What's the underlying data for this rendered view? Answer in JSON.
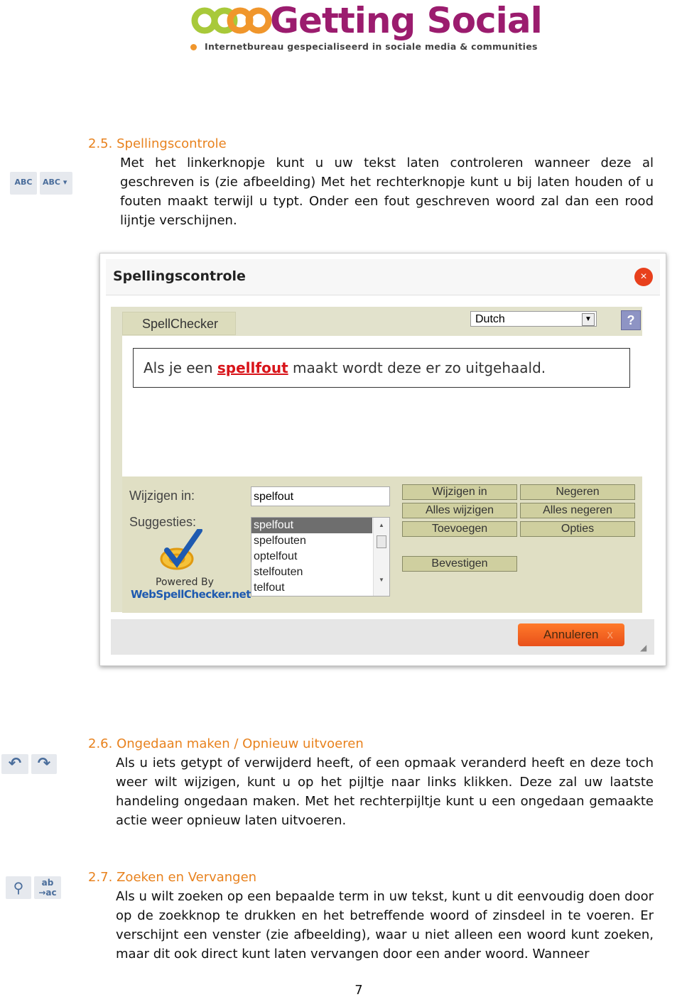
{
  "logo": {
    "title": "Getting Social",
    "tagline": "Internetbureau gespecialiseerd in sociale media & communities",
    "colors": {
      "purple": "#9b1c6e",
      "green": "#a8c93a",
      "orange": "#f0962c"
    }
  },
  "sections": [
    {
      "number": "2.5.",
      "title": "Spellingscontrole",
      "icons": [
        "spellcheck-icon",
        "spellcheck-dropdown-icon"
      ],
      "icon_text": "ABC",
      "body": "Met het linkerknopje kunt u uw tekst laten controleren wanneer deze al geschreven is (zie afbeelding) Met het rechterknopje kunt u bij laten houden of u fouten maakt terwijl u typt. Onder een fout geschreven woord zal dan een rood lijntje verschijnen."
    },
    {
      "number": "2.6.",
      "title": "Ongedaan maken / Opnieuw uitvoeren",
      "icons": [
        "undo-icon",
        "redo-icon"
      ],
      "body": "Als u iets getypt of verwijderd heeft, of een opmaak veranderd heeft en deze toch weer wilt wijzigen, kunt u op het pijltje naar links klikken. Deze zal uw laatste handeling ongedaan maken. Met het rechterpijltje kunt u een ongedaan gemaakte actie weer opnieuw laten uitvoeren."
    },
    {
      "number": "2.7.",
      "title": "Zoeken en Vervangen",
      "icons": [
        "find-icon",
        "replace-icon"
      ],
      "body": "Als u wilt zoeken op een bepaalde term in uw tekst, kunt u dit eenvoudig doen door op de zoekknop te drukken en het betreffende woord of zinsdeel in te voeren. Er verschijnt een venster (zie afbeelding), waar u niet alleen een woord kunt zoeken, maar dit ook direct kunt laten vervangen door een ander woord. Wanneer"
    }
  ],
  "dialog": {
    "title": "Spellingscontrole",
    "tab": "SpellChecker",
    "language": "Dutch",
    "help": "?",
    "sentence": {
      "before": "Als je een ",
      "error": "spellfout",
      "after": " maakt wordt deze er zo uitgehaald."
    },
    "change_to_label": "Wijzigen in:",
    "change_to_value": "spelfout",
    "suggestions_label": "Suggesties:",
    "suggestions": [
      "spelfout",
      "spelfouten",
      "optelfout",
      "stelfouten",
      "telfout"
    ],
    "selected_suggestion": "spelfout",
    "buttons": {
      "change": "Wijzigen in",
      "ignore": "Negeren",
      "change_all": "Alles wijzigen",
      "ignore_all": "Alles negeren",
      "add": "Toevoegen",
      "options": "Opties",
      "confirm": "Bevestigen",
      "cancel": "Annuleren"
    },
    "powered_by": "Powered By",
    "powered_brand": "WebSpellChecker.net"
  },
  "page_number": "7"
}
